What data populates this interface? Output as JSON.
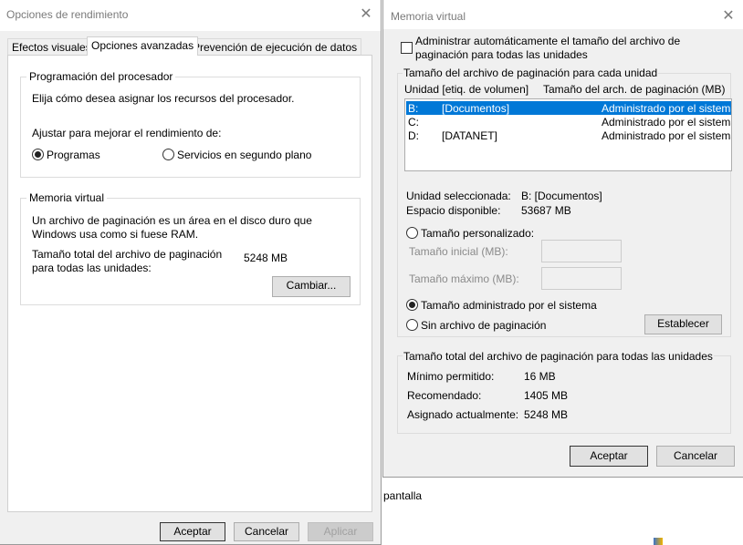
{
  "background": {
    "text": "pantalla"
  },
  "perf_window": {
    "title": "Opciones de rendimiento",
    "tabs": [
      {
        "label": "Efectos visuales"
      },
      {
        "label": "Opciones avanzadas"
      },
      {
        "label": "Prevención de ejecución de datos"
      }
    ],
    "scheduling": {
      "legend": "Programación del procesador",
      "description": "Elija cómo desea asignar los recursos del procesador.",
      "adjust_label": "Ajustar para mejorar el rendimiento de:",
      "option_programs": "Programas",
      "option_services": "Servicios en segundo plano",
      "selected": "programs"
    },
    "virtual_memory": {
      "legend": "Memoria virtual",
      "description_line1": "Un archivo de paginación es un área en el disco duro que",
      "description_line2": "Windows usa como si fuese RAM.",
      "total_label_line1": "Tamaño total del archivo de paginación",
      "total_label_line2": "para todas las unidades:",
      "total_value": "5248 MB",
      "change_button": "Cambiar..."
    },
    "buttons": {
      "accept": "Aceptar",
      "cancel": "Cancelar",
      "apply": "Aplicar"
    }
  },
  "vm_window": {
    "title": "Memoria virtual",
    "auto_manage_line1": "Administrar automáticamente el tamaño del archivo de",
    "auto_manage_line2": "paginación para todas las unidades",
    "auto_manage_checked": false,
    "drives_legend": "Tamaño del archivo de paginación para cada unidad",
    "col_drive": "Unidad [etiq. de volumen]",
    "col_size": "Tamaño del arch. de paginación (MB)",
    "drives": [
      {
        "letter": "B:",
        "label": "[Documentos]",
        "size": "Administrado por el sistema",
        "selected": true
      },
      {
        "letter": "C:",
        "label": "",
        "size": "Administrado por el sistema",
        "selected": false
      },
      {
        "letter": "D:",
        "label": "[DATANET]",
        "size": "Administrado por el sistema",
        "selected": false
      }
    ],
    "selected_drive_label": "Unidad seleccionada:",
    "selected_drive_value": "B:  [Documentos]",
    "free_space_label": "Espacio disponible:",
    "free_space_value": "53687 MB",
    "custom_size": "Tamaño personalizado:",
    "initial_size_label": "Tamaño inicial (MB):",
    "max_size_label": "Tamaño máximo (MB):",
    "system_managed": "Tamaño administrado por el sistema",
    "no_paging": "Sin archivo de paginación",
    "size_option_selected": "system_managed",
    "set_button": "Establecer",
    "totals_legend": "Tamaño total del archivo de paginación para todas las unidades",
    "min_label": "Mínimo permitido:",
    "min_value": "16 MB",
    "recommended_label": "Recomendado:",
    "recommended_value": "1405 MB",
    "current_label": "Asignado actualmente:",
    "current_value": "5248 MB",
    "buttons": {
      "accept": "Aceptar",
      "cancel": "Cancelar"
    }
  }
}
